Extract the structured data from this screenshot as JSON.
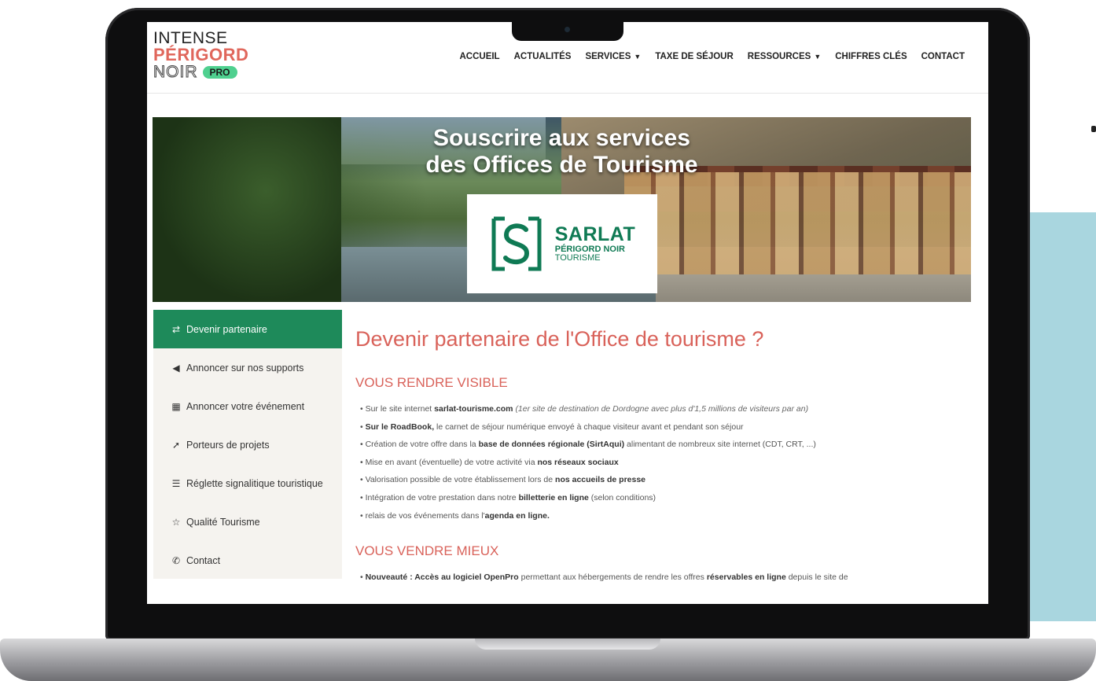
{
  "header": {
    "logo_line1": "INTENSE",
    "logo_line2": "PÉRIGORD",
    "logo_line3": "NOIR",
    "logo_badge": "PRO",
    "nav": [
      {
        "label": "ACCUEIL",
        "has_caret": false
      },
      {
        "label": "ACTUALITÉS",
        "has_caret": false
      },
      {
        "label": "SERVICES",
        "has_caret": true
      },
      {
        "label": "TAXE DE SÉJOUR",
        "has_caret": false
      },
      {
        "label": "RESSOURCES",
        "has_caret": true
      },
      {
        "label": "CHIFFRES CLÉS",
        "has_caret": false
      },
      {
        "label": "CONTACT",
        "has_caret": false
      }
    ]
  },
  "hero": {
    "title_line1": "Souscrire aux services",
    "title_line2": "des Offices de Tourisme",
    "badge_line1": "SARLAT",
    "badge_line2": "PÉRIGORD NOIR",
    "badge_line3": "TOURISME"
  },
  "sidebar": {
    "items": [
      {
        "label": "Devenir partenaire",
        "icon": "handshake-icon",
        "active": true
      },
      {
        "label": "Annoncer sur nos supports",
        "icon": "megaphone-icon",
        "active": false
      },
      {
        "label": "Annoncer votre événement",
        "icon": "calendar-icon",
        "active": false
      },
      {
        "label": "Porteurs de projets",
        "icon": "rocket-icon",
        "active": false
      },
      {
        "label": "Réglette signalitique touristique",
        "icon": "signpost-icon",
        "active": false
      },
      {
        "label": "Qualité Tourisme",
        "icon": "star-icon",
        "active": false
      },
      {
        "label": "Contact",
        "icon": "phone-icon",
        "active": false
      }
    ]
  },
  "main": {
    "title": "Devenir partenaire de l'Office de tourisme ?",
    "section1_title": "VOUS RENDRE VISIBLE",
    "section1_bullets": [
      {
        "a": "Sur le site internet ",
        "b": "sarlat-tourisme.com",
        "c": " ",
        "i": "(1er site de destination de Dordogne avec plus d'1,5 millions de visiteurs par an)"
      },
      {
        "a": "",
        "b": "Sur le RoadBook,",
        "c": " le carnet de séjour numérique envoyé à chaque visiteur avant et pendant son séjour",
        "i": ""
      },
      {
        "a": "Création de votre offre dans la ",
        "b": "base de données régionale (SirtAqui)",
        "c": " alimentant de nombreux site internet (CDT, CRT, ...)",
        "i": ""
      },
      {
        "a": "Mise en avant (éventuelle) de votre activité via ",
        "b": "nos réseaux sociaux",
        "c": "",
        "i": ""
      },
      {
        "a": "Valorisation possible de votre établissement lors de ",
        "b": "nos accueils de presse",
        "c": "",
        "i": ""
      },
      {
        "a": "Intégration de votre prestation dans notre ",
        "b": "billetterie en ligne",
        "c": " (selon conditions)",
        "i": ""
      },
      {
        "a": "relais de vos événements dans l'",
        "b": "agenda en ligne.",
        "c": "",
        "i": ""
      }
    ],
    "section2_title": "VOUS VENDRE MIEUX",
    "section2_bullets": [
      {
        "a": "",
        "b": "Nouveauté : Accès au logiciel OpenPro",
        "c": " permettant aux hébergements de rendre les offres ",
        "b2": "réservables en ligne",
        "d": " depuis le site de"
      }
    ]
  }
}
